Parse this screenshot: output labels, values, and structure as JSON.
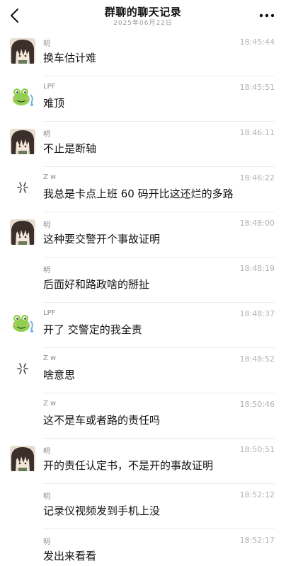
{
  "header": {
    "title": "群聊的聊天记录",
    "date": "2025年06月22日"
  },
  "messages": [
    {
      "name": "明",
      "time": "18:45:44",
      "text": "换车估计难",
      "avatar": "hair-avatar"
    },
    {
      "name": "LPF",
      "time": "18:45:51",
      "text": "难顶",
      "avatar": "frog-avatar"
    },
    {
      "name": "明",
      "time": "18:46:11",
      "text": "不止是断轴",
      "avatar": "hair-avatar"
    },
    {
      "name": "Z w",
      "time": "18:46:22",
      "text": "我总是卡点上班 60 码开比这还烂的多路",
      "avatar": "spark-avatar"
    },
    {
      "name": "明",
      "time": "18:48:00",
      "text": "这种要交警开个事故证明",
      "avatar": "hair-avatar"
    },
    {
      "name": "明",
      "time": "18:48:19",
      "text": "后面好和路政啥的掰扯",
      "avatar": "none"
    },
    {
      "name": "LPF",
      "time": "18:48:37",
      "text": "开了 交警定的我全责",
      "avatar": "frog-avatar"
    },
    {
      "name": "Z w",
      "time": "18:48:52",
      "text": "啥意思",
      "avatar": "spark-avatar"
    },
    {
      "name": "Z w",
      "time": "18:50:46",
      "text": "这不是车或者路的责任吗",
      "avatar": "none"
    },
    {
      "name": "明",
      "time": "18:50:51",
      "text": "开的责任认定书，不是开的事故证明",
      "avatar": "hair-avatar"
    },
    {
      "name": "明",
      "time": "18:52:12",
      "text": "记录仪视频发到手机上没",
      "avatar": "none"
    },
    {
      "name": "明",
      "time": "18:52:17",
      "text": "发出来看看",
      "avatar": "none"
    }
  ]
}
